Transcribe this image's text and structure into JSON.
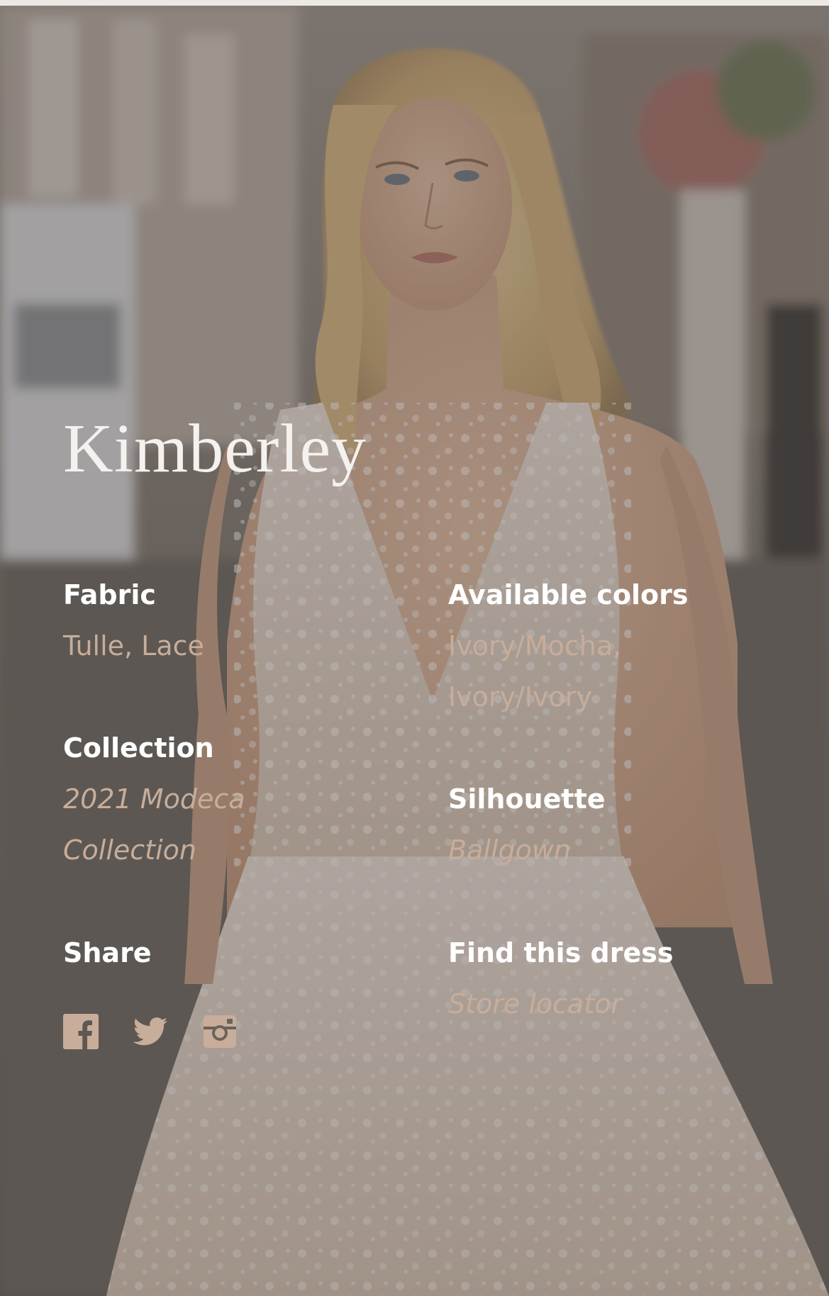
{
  "dress": {
    "name": "Kimberley"
  },
  "details": {
    "fabric": {
      "label": "Fabric",
      "value": "Tulle, Lace"
    },
    "available_colors": {
      "label": "Available colors",
      "lines": [
        "Ivory/Mocha,",
        "Ivory/Ivory"
      ]
    },
    "collection": {
      "label": "Collection",
      "lines": [
        "2021 Modeca",
        "Collection"
      ]
    },
    "silhouette": {
      "label": "Silhouette",
      "value": "Ballgown"
    },
    "share": {
      "label": "Share",
      "icons": [
        "facebook-icon",
        "twitter-icon",
        "instagram-icon"
      ]
    },
    "find": {
      "label": "Find this dress",
      "link": "Store locator"
    }
  },
  "colors": {
    "label_text": "#ffffff",
    "value_text": "#c7ad9a",
    "title_text": "#f4f1ee",
    "icon": "#c7ad9a"
  }
}
